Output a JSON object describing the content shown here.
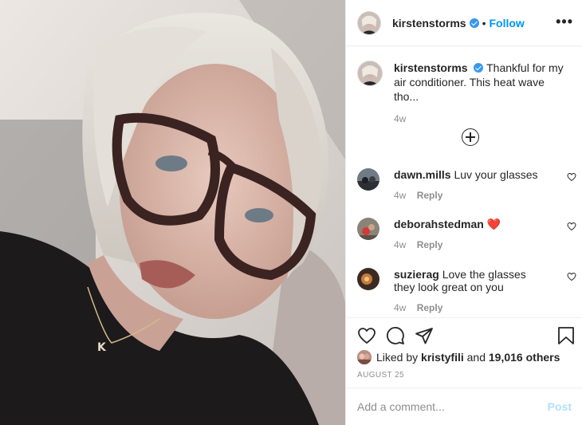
{
  "post": {
    "username": "kirstenstorms",
    "separator": "•",
    "follow_label": "Follow",
    "more_label": "•••"
  },
  "caption": {
    "username": "kirstenstorms",
    "text": "Thankful for my air conditioner. This heat wave tho...",
    "age": "4w"
  },
  "comments": [
    {
      "username": "dawn.mills",
      "text": "Luv your glasses",
      "age": "4w",
      "reply_label": "Reply"
    },
    {
      "username": "deborahstedman",
      "text": "❤️",
      "age": "4w",
      "reply_label": "Reply"
    },
    {
      "username": "suzierag",
      "text": "Love the glasses they look great on you",
      "age": "4w",
      "reply_label": "Reply"
    }
  ],
  "likes": {
    "prefix": "Liked by",
    "user": "kristyfili",
    "middle": "and",
    "others": "19,016 others"
  },
  "date": "AUGUST 25",
  "add_comment": {
    "placeholder": "Add a comment...",
    "post_label": "Post"
  },
  "icons": [
    "verified-badge-icon",
    "more-options-icon",
    "load-more-comments-icon",
    "heart-icon",
    "comment-icon",
    "share-icon",
    "bookmark-icon"
  ],
  "colors": {
    "link": "#0095f6",
    "verified": "#3897f0",
    "post_disabled": "#b2dffc",
    "muted": "#8e8e8e"
  }
}
